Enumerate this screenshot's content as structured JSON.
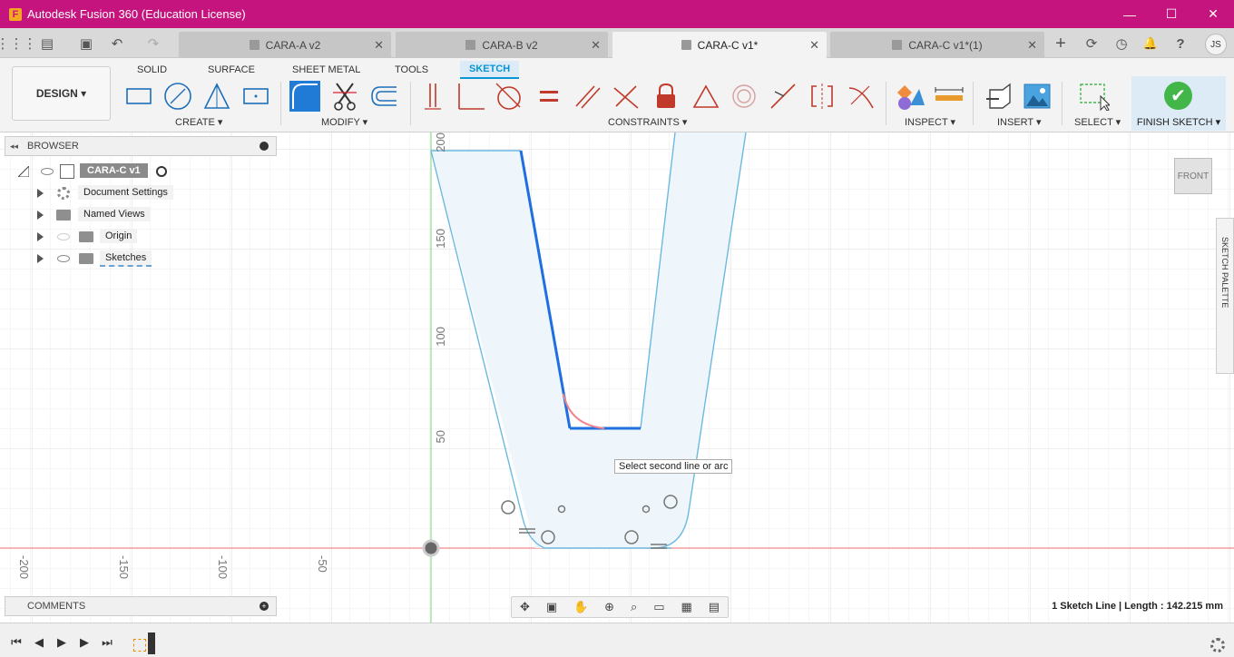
{
  "window": {
    "title": "Autodesk Fusion 360 (Education License)",
    "logo_letter": "F",
    "minimize": "—",
    "maximize": "☐",
    "close": "✕"
  },
  "tabs": [
    {
      "label": "CARA-A v2",
      "active": false
    },
    {
      "label": "CARA-B v2",
      "active": false
    },
    {
      "label": "CARA-C v1*",
      "active": true
    },
    {
      "label": "CARA-C v1*(1)",
      "active": false
    }
  ],
  "tab_close": "✕",
  "user_initials": "JS",
  "workspace": {
    "label": "DESIGN ▾"
  },
  "ribbon_tabs": [
    "SOLID",
    "SURFACE",
    "SHEET METAL",
    "TOOLS",
    "SKETCH"
  ],
  "groups": {
    "create": "CREATE ▾",
    "modify": "MODIFY ▾",
    "constraints": "CONSTRAINTS ▾",
    "inspect": "INSPECT ▾",
    "insert": "INSERT ▾",
    "select": "SELECT ▾",
    "finish": "FINISH SKETCH ▾"
  },
  "finish_check": "✔",
  "browser": {
    "title": "BROWSER",
    "root": "CARA-C v1",
    "items": [
      "Document Settings",
      "Named Views",
      "Origin",
      "Sketches"
    ]
  },
  "comments": {
    "title": "COMMENTS"
  },
  "canvas": {
    "tooltip": "Select second line or arc",
    "y_ticks": [
      "200",
      "150",
      "100",
      "50"
    ],
    "x_ticks": [
      "-200",
      "-150",
      "-100",
      "-50"
    ],
    "viewcube_label": "FRONT",
    "sketch_palette": "SKETCH PALETTE"
  },
  "status": "1 Sketch Line | Length : 142.215 mm",
  "icons": {
    "grid": "⋮⋮⋮",
    "file": "▤",
    "save": "▣",
    "undo": "↶",
    "redo": "↷",
    "add": "+",
    "refresh": "⟳",
    "clock": "◷",
    "bell": "🔔",
    "help": "?",
    "first": "⏮",
    "prev": "◀",
    "play": "▶",
    "next": "▶",
    "last": "⏭",
    "collapse": "◂◂"
  },
  "nav_tools": [
    "✥",
    "▣",
    "✋",
    "⊕",
    "⌕",
    "▭",
    "▦",
    "▤"
  ],
  "colors": {
    "title_bar": "#c5147e",
    "accent": "#0696d7",
    "finish_green": "#42b649",
    "profile_fill": "#eef6fc",
    "profile_line": "#6cb9e0",
    "selected_line": "#1f6fe0",
    "fillet_preview": "#f0838e"
  }
}
